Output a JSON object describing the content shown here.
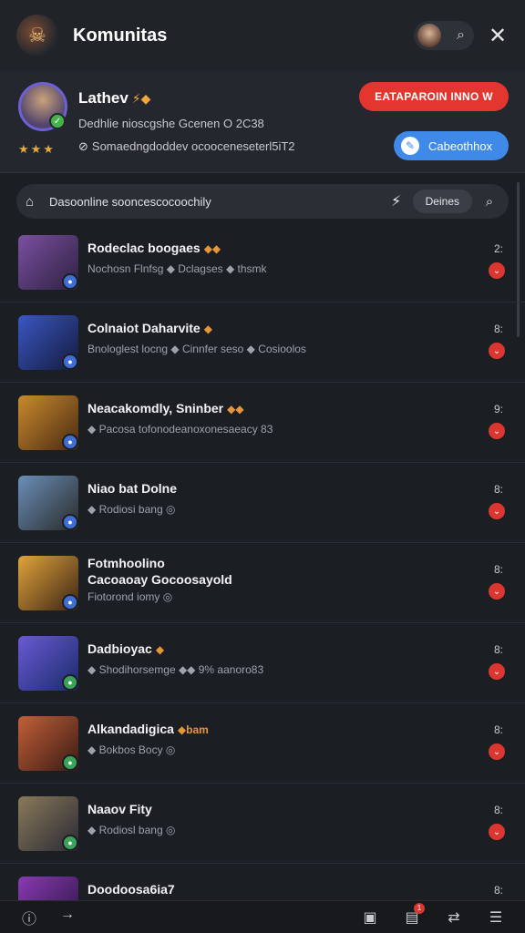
{
  "header": {
    "title": "Komunitas",
    "logo_icon": "game-logo-icon",
    "search_icon": "search-icon",
    "close_glyph": "✕"
  },
  "profile": {
    "name": "Lathev",
    "name_badges": "⚡◆",
    "line2": "Dedhlie nioscgshe Gcenen  O 2C38",
    "stars": "★★★",
    "line3": "Somaedngdoddev ocooceneseterl5iT2",
    "red_button": "EATAPAROIN INNO W",
    "blue_button": "Cabeothhox",
    "colors": {
      "red": "#e2362f",
      "blue": "#3f8ae8",
      "avatar_ring": "#6d5fd6"
    }
  },
  "filter": {
    "text": "Dasoonline sooncescocoochily",
    "chip": "Deines"
  },
  "items": [
    {
      "title": "Rodeclac boogaes",
      "title_badge": "◆◆",
      "sub": "Nochosn Flnfsg  ◆ Dclagses  ◆ thsmk",
      "meta": "2:",
      "thumb_a": "#7b4fa0",
      "thumb_b": "#2c2140",
      "badge_color": "#3f6fd6"
    },
    {
      "title": "Colnaiot Daharvite",
      "title_badge": "◆",
      "sub": "Bnologlest locng  ◆ Cinnfer seso  ◆ Cosioolos",
      "meta": "8:",
      "thumb_a": "#3a57c4",
      "thumb_b": "#141a3a",
      "badge_color": "#3f6fd6"
    },
    {
      "title": "Neacakomdly, Sninber",
      "title_badge": "◆◆",
      "sub": "◆ Pacosa tofonodeanoxonesaeacy 83",
      "meta": "9:",
      "thumb_a": "#c98a2c",
      "thumb_b": "#4a2a12",
      "badge_color": "#3f6fd6"
    },
    {
      "title": "Niao bat Dolne",
      "title_badge": "",
      "sub": "◆ Rodiosi bang ◎",
      "meta": "8:",
      "thumb_a": "#6a8fb8",
      "thumb_b": "#2a2a2a",
      "badge_color": "#3f6fd6"
    },
    {
      "title": "Fotmhoolino",
      "title2": "Cacoaoay Gocoosayold",
      "title_badge": "",
      "sub": "Fiotorond iomy ◎",
      "meta": "8:",
      "thumb_a": "#e2a33c",
      "thumb_b": "#3a2414",
      "badge_color": "#3f6fd6"
    },
    {
      "title": "Dadbioyac",
      "title_badge": "◆",
      "sub": "◆ Shodihorsemge ◆◆ 9%  aanoro83",
      "meta": "8:",
      "thumb_a": "#6a5ad4",
      "thumb_b": "#1a2a6a",
      "badge_color": "#3aa35a"
    },
    {
      "title": "Alkandadigica",
      "title_badge": "◆bam",
      "sub": "◆ Bokbos Bocy ◎",
      "meta": "8:",
      "thumb_a": "#c2603a",
      "thumb_b": "#3a1a12",
      "badge_color": "#3aa35a"
    },
    {
      "title": "Naaov Fity",
      "title_badge": "",
      "sub": "◆ Rodiosl bang ◎",
      "meta": "8:",
      "thumb_a": "#8a7a5a",
      "thumb_b": "#2a2a34",
      "badge_color": "#3aa35a"
    },
    {
      "title": "Doodoosa6ia7",
      "title_badge": "",
      "sub": "",
      "meta": "8:",
      "thumb_a": "#8a3ab4",
      "thumb_b": "#2a1440",
      "badge_color": "#3f6fd6"
    }
  ],
  "bottom_nav": {
    "notification_count": "1"
  }
}
